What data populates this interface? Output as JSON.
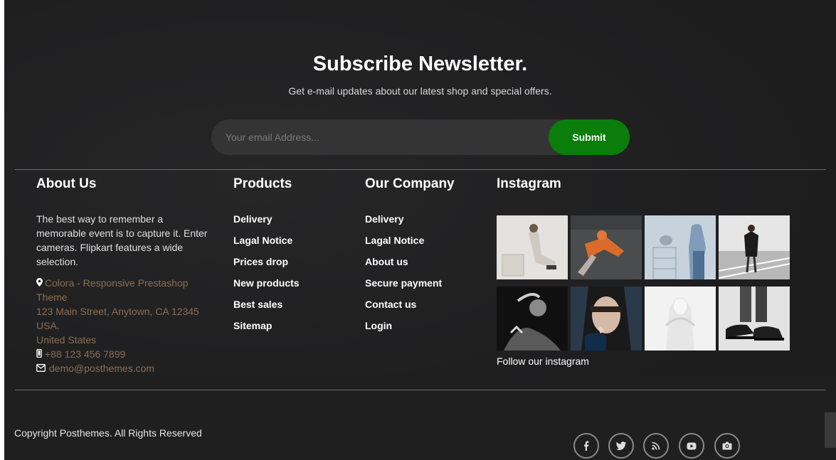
{
  "newsletter": {
    "title": "Subscribe Newsletter.",
    "subtitle": "Get e-mail updates about our latest shop and special offers.",
    "email_placeholder": "Your email Address...",
    "submit_label": "Submit"
  },
  "about": {
    "title": "About Us",
    "text": "The best way to remember a memorable event is to capture it. Enter cameras. Flipkart features a wide selection.",
    "store_name_line1": "Colora - Responsive Prestashop",
    "store_name_line2": "Theme",
    "address_line1": "123 Main Street, Anytown, CA 12345",
    "address_line2": "USA.",
    "address_line3": "United States",
    "phone": "+88 123 456 7899",
    "email": "demo@posthemes.com"
  },
  "products": {
    "title": "Products",
    "links": [
      "Delivery",
      "Lagal Notice",
      "Prices drop",
      "New products",
      "Best sales",
      "Sitemap"
    ]
  },
  "company": {
    "title": "Our Company",
    "links": [
      "Delivery",
      "Lagal Notice",
      "About us",
      "Secure payment",
      "Contact us",
      "Login"
    ]
  },
  "instagram": {
    "title": "Instagram",
    "follow_text": "Follow our instagram",
    "tiles": [
      "instagram-photo-1",
      "instagram-photo-2",
      "instagram-photo-3",
      "instagram-photo-4",
      "instagram-photo-5",
      "instagram-photo-6",
      "instagram-photo-7",
      "instagram-photo-8"
    ]
  },
  "footer": {
    "copyright": "Copyright Posthemes. All Rights Reserved",
    "social": [
      "facebook-icon",
      "twitter-icon",
      "rss-icon",
      "youtube-icon",
      "camera-icon"
    ]
  },
  "colors": {
    "background": "#1f1f20",
    "submit": "#0a7d0a",
    "contact_text": "#8a6e54"
  }
}
